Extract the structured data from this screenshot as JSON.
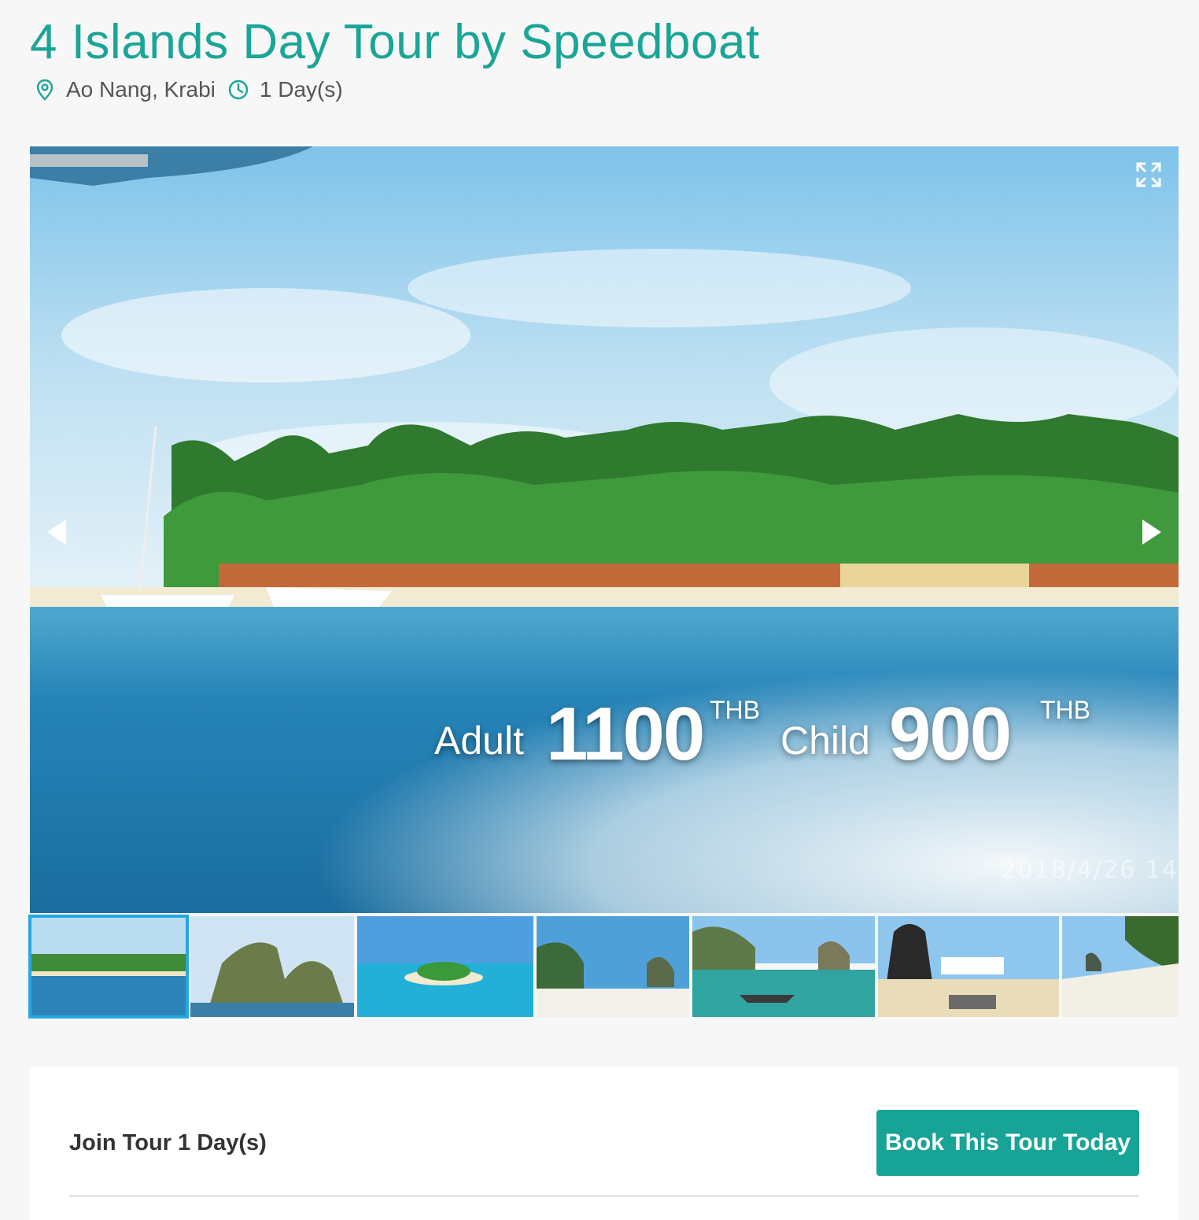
{
  "tour": {
    "title": "4 Islands Day Tour by Speedboat",
    "location": "Ao Nang, Krabi",
    "duration": "1 Day(s)"
  },
  "pricing": {
    "adult_label": "Adult",
    "adult_price": "1100",
    "child_label": "Child",
    "child_price": "900",
    "currency": "THB"
  },
  "gallery": {
    "photo_timestamp": "2018/4/26  14",
    "thumbnails": [
      {
        "label": "Beach with sailboat"
      },
      {
        "label": "Chicken Island rock"
      },
      {
        "label": "Small tropical island"
      },
      {
        "label": "White sand beach with rock"
      },
      {
        "label": "Longtail boat near cliffs"
      },
      {
        "label": "Poda Island sign"
      },
      {
        "label": "Beach and rock islet"
      }
    ]
  },
  "booking": {
    "join_text": "Join Tour 1 Day(s)",
    "button_label": "Book This Tour Today"
  },
  "icons": {
    "location": "map-pin-icon",
    "duration": "clock-icon",
    "fullscreen": "expand-icon",
    "prev": "chevron-left-icon",
    "next": "chevron-right-icon"
  },
  "colors": {
    "accent": "#1aa597",
    "button": "#18a397",
    "thumb_active": "#26a7e0"
  }
}
